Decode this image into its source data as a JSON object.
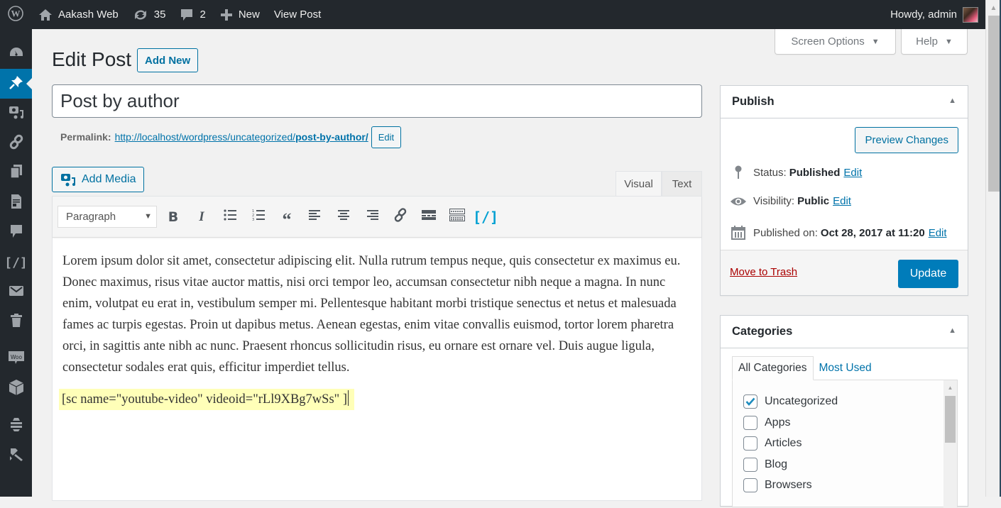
{
  "admin_bar": {
    "site_name": "Aakash Web",
    "updates_count": "35",
    "comments_count": "2",
    "new_label": "New",
    "view_post_label": "View Post",
    "greeting": "Howdy, admin"
  },
  "sidebar": {
    "items": [
      {
        "icon": "dashboard-icon"
      },
      {
        "icon": "posts-pin-icon",
        "active": true
      },
      {
        "icon": "media-icon"
      },
      {
        "icon": "links-icon"
      },
      {
        "icon": "pages-icon"
      },
      {
        "icon": "forms-icon"
      },
      {
        "icon": "comments-icon"
      },
      {
        "icon": "shortcode-icon"
      },
      {
        "icon": "mail-icon"
      },
      {
        "icon": "trash-icon"
      },
      {
        "icon": "woocommerce-icon",
        "text": "Woo"
      },
      {
        "icon": "products-icon"
      },
      {
        "icon": "plugin-icon"
      },
      {
        "icon": "tools-icon"
      }
    ]
  },
  "screen_meta": {
    "screen_options_label": "Screen Options",
    "help_label": "Help"
  },
  "header": {
    "title": "Edit Post",
    "add_new_label": "Add New"
  },
  "post": {
    "title": "Post by author",
    "permalink_label": "Permalink:",
    "permalink_base": "http://localhost/wordpress/uncategorized/",
    "permalink_slug": "post-by-author/",
    "permalink_edit_label": "Edit"
  },
  "editor": {
    "add_media_label": "Add Media",
    "tabs": {
      "visual": "Visual",
      "text": "Text"
    },
    "active_tab": "Visual",
    "format_select": "Paragraph",
    "toolbar": [
      "bold",
      "italic",
      "bulleted-list",
      "numbered-list",
      "blockquote",
      "align-left",
      "align-center",
      "align-right",
      "insert-link",
      "read-more",
      "toolbar-toggle",
      "shortcode"
    ],
    "paragraph": "Lorem ipsum dolor sit amet, consectetur adipiscing elit. Nulla rutrum tempus neque, quis consectetur ex maximus eu. Donec maximus, risus vitae auctor mattis, nisi orci tempor leo, accumsan consectetur nibh neque a magna. In nunc enim, volutpat eu erat in, vestibulum semper mi. Pellentesque habitant morbi tristique senectus et netus et malesuada fames ac turpis egestas. Proin ut dapibus metus. Aenean egestas, enim vitae convallis euismod, tortor lorem pharetra orci, in sagittis ante nibh ac nunc. Praesent rhoncus sollicitudin risus, eu ornare est ornare vel. Duis augue ligula, consectetur sodales erat quis, efficitur imperdiet tellus.",
    "shortcode": "[sc name=\"youtube-video\" videoid=\"rLl9XBg7wSs\" ]",
    "shortcode_highlight": "#ffffb8"
  },
  "publish": {
    "title": "Publish",
    "preview_label": "Preview Changes",
    "status_label": "Status:",
    "status_value": "Published",
    "visibility_label": "Visibility:",
    "visibility_value": "Public",
    "published_label": "Published on:",
    "published_value": "Oct 28, 2017 at 11:20",
    "edit_label": "Edit",
    "trash_label": "Move to Trash",
    "update_label": "Update",
    "update_color": "#007cba"
  },
  "categories": {
    "title": "Categories",
    "tabs": {
      "all": "All Categories",
      "most_used": "Most Used"
    },
    "items": [
      {
        "label": "Uncategorized",
        "checked": true
      },
      {
        "label": "Apps",
        "checked": false
      },
      {
        "label": "Articles",
        "checked": false
      },
      {
        "label": "Blog",
        "checked": false
      },
      {
        "label": "Browsers",
        "checked": false
      }
    ]
  }
}
